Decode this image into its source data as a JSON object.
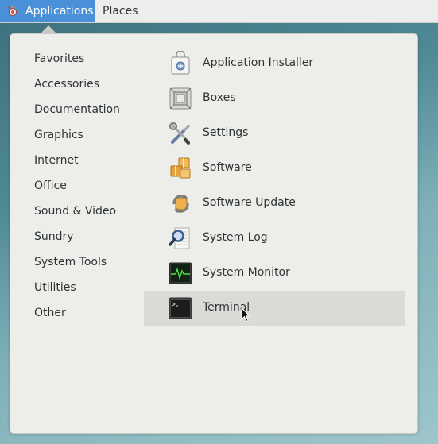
{
  "topbar": {
    "applications_label": "Applications",
    "places_label": "Places",
    "applications_icon": "gnome-foot-icon"
  },
  "categories": [
    {
      "label": "Favorites"
    },
    {
      "label": "Accessories"
    },
    {
      "label": "Documentation"
    },
    {
      "label": "Graphics"
    },
    {
      "label": "Internet"
    },
    {
      "label": "Office"
    },
    {
      "label": "Sound & Video"
    },
    {
      "label": "Sundry"
    },
    {
      "label": "System Tools"
    },
    {
      "label": "Utilities"
    },
    {
      "label": "Other"
    }
  ],
  "apps": [
    {
      "label": "Application Installer",
      "icon": "package-installer-icon"
    },
    {
      "label": "Boxes",
      "icon": "boxes-icon"
    },
    {
      "label": "Settings",
      "icon": "settings-tools-icon"
    },
    {
      "label": "Software",
      "icon": "software-packages-icon"
    },
    {
      "label": "Software Update",
      "icon": "software-update-icon"
    },
    {
      "label": "System Log",
      "icon": "system-log-icon"
    },
    {
      "label": "System Monitor",
      "icon": "system-monitor-icon"
    },
    {
      "label": "Terminal",
      "icon": "terminal-icon",
      "highlighted": true
    }
  ],
  "colors": {
    "accent": "#4a90d9",
    "menu_bg": "#edeeea",
    "highlight": "#dadbd7",
    "text": "#2e3436"
  }
}
